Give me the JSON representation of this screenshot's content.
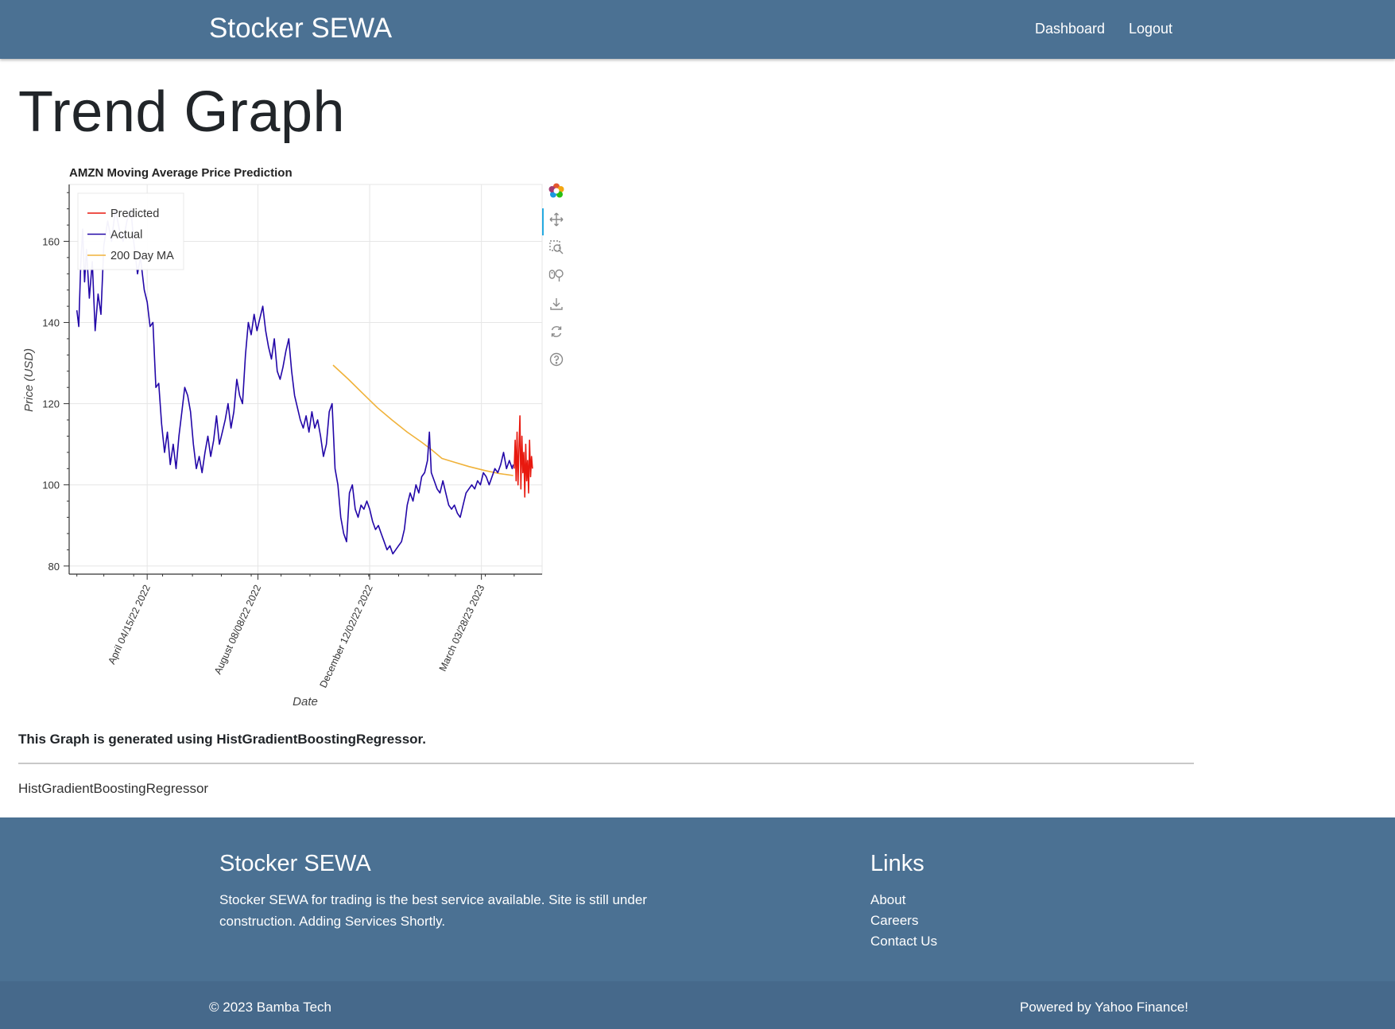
{
  "navbar": {
    "brand": "Stocker SEWA",
    "links": [
      "Dashboard",
      "Logout"
    ]
  },
  "page": {
    "title": "Trend Graph",
    "caption": "This Graph is generated using HistGradientBoostingRegressor.",
    "model_name": "HistGradientBoostingRegressor"
  },
  "toolbar": {
    "icons": [
      "bokeh-logo-icon",
      "pan-icon",
      "box-zoom-icon",
      "wheel-zoom-icon",
      "save-icon",
      "reset-icon",
      "help-icon"
    ]
  },
  "chart_data": {
    "type": "line",
    "title": "AMZN Moving Average Price Prediction",
    "xlabel": "Date",
    "ylabel": "Price (USD)",
    "ylim": [
      78,
      174
    ],
    "xlim": [
      "2022-01-24",
      "2023-05-30"
    ],
    "x_ticks": [
      {
        "date": "2022-04-15",
        "label": "April 04/15/22 2022"
      },
      {
        "date": "2022-08-08",
        "label": "August 08/08/22 2022"
      },
      {
        "date": "2022-12-02",
        "label": "December 12/02/22 2022"
      },
      {
        "date": "2023-03-28",
        "label": "March 03/28/23 2023"
      }
    ],
    "y_ticks": [
      80,
      100,
      120,
      140,
      160
    ],
    "grid": true,
    "legend_position": "top-left",
    "series": [
      {
        "name": "Predicted",
        "color": "#e8190f",
        "points": [
          [
            "2023-05-01",
            104
          ],
          [
            "2023-05-02",
            111
          ],
          [
            "2023-05-03",
            101
          ],
          [
            "2023-05-04",
            113
          ],
          [
            "2023-05-05",
            100
          ],
          [
            "2023-05-06",
            109
          ],
          [
            "2023-05-07",
            117
          ],
          [
            "2023-05-08",
            99
          ],
          [
            "2023-05-09",
            112
          ],
          [
            "2023-05-10",
            103
          ],
          [
            "2023-05-11",
            108
          ],
          [
            "2023-05-12",
            97
          ],
          [
            "2023-05-13",
            110
          ],
          [
            "2023-05-14",
            101
          ],
          [
            "2023-05-15",
            106
          ],
          [
            "2023-05-16",
            98
          ],
          [
            "2023-05-17",
            111
          ],
          [
            "2023-05-18",
            102
          ],
          [
            "2023-05-19",
            107
          ],
          [
            "2023-05-20",
            104
          ]
        ]
      },
      {
        "name": "Actual",
        "color": "#2307a8",
        "points": [
          [
            "2022-02-01",
            143
          ],
          [
            "2022-02-03",
            139
          ],
          [
            "2022-02-05",
            154
          ],
          [
            "2022-02-07",
            163
          ],
          [
            "2022-02-09",
            150
          ],
          [
            "2022-02-11",
            158
          ],
          [
            "2022-02-14",
            146
          ],
          [
            "2022-02-17",
            155
          ],
          [
            "2022-02-20",
            138
          ],
          [
            "2022-02-23",
            147
          ],
          [
            "2022-02-26",
            142
          ],
          [
            "2022-03-01",
            159
          ],
          [
            "2022-03-05",
            165
          ],
          [
            "2022-03-09",
            160
          ],
          [
            "2022-03-13",
            168
          ],
          [
            "2022-03-17",
            163
          ],
          [
            "2022-03-21",
            160
          ],
          [
            "2022-03-25",
            165
          ],
          [
            "2022-03-29",
            168
          ],
          [
            "2022-04-01",
            160
          ],
          [
            "2022-04-05",
            152
          ],
          [
            "2022-04-08",
            156
          ],
          [
            "2022-04-12",
            148
          ],
          [
            "2022-04-15",
            145
          ],
          [
            "2022-04-18",
            139
          ],
          [
            "2022-04-21",
            140
          ],
          [
            "2022-04-24",
            124
          ],
          [
            "2022-04-27",
            125
          ],
          [
            "2022-04-30",
            115
          ],
          [
            "2022-05-03",
            108
          ],
          [
            "2022-05-06",
            113
          ],
          [
            "2022-05-09",
            105
          ],
          [
            "2022-05-12",
            110
          ],
          [
            "2022-05-15",
            104
          ],
          [
            "2022-05-18",
            112
          ],
          [
            "2022-05-21",
            118
          ],
          [
            "2022-05-24",
            124
          ],
          [
            "2022-05-27",
            122
          ],
          [
            "2022-05-30",
            118
          ],
          [
            "2022-06-02",
            110
          ],
          [
            "2022-06-05",
            104
          ],
          [
            "2022-06-08",
            107
          ],
          [
            "2022-06-11",
            103
          ],
          [
            "2022-06-14",
            108
          ],
          [
            "2022-06-17",
            112
          ],
          [
            "2022-06-20",
            107
          ],
          [
            "2022-06-23",
            111
          ],
          [
            "2022-06-26",
            117
          ],
          [
            "2022-06-29",
            110
          ],
          [
            "2022-07-02",
            113
          ],
          [
            "2022-07-05",
            116
          ],
          [
            "2022-07-08",
            120
          ],
          [
            "2022-07-11",
            114
          ],
          [
            "2022-07-14",
            118
          ],
          [
            "2022-07-17",
            126
          ],
          [
            "2022-07-20",
            122
          ],
          [
            "2022-07-23",
            120
          ],
          [
            "2022-07-26",
            132
          ],
          [
            "2022-07-29",
            140
          ],
          [
            "2022-08-01",
            137
          ],
          [
            "2022-08-04",
            142
          ],
          [
            "2022-08-07",
            138
          ],
          [
            "2022-08-10",
            141
          ],
          [
            "2022-08-13",
            144
          ],
          [
            "2022-08-16",
            138
          ],
          [
            "2022-08-19",
            134
          ],
          [
            "2022-08-22",
            131
          ],
          [
            "2022-08-25",
            136
          ],
          [
            "2022-08-28",
            128
          ],
          [
            "2022-08-31",
            126
          ],
          [
            "2022-09-03",
            129
          ],
          [
            "2022-09-06",
            133
          ],
          [
            "2022-09-09",
            136
          ],
          [
            "2022-09-12",
            128
          ],
          [
            "2022-09-15",
            122
          ],
          [
            "2022-09-18",
            119
          ],
          [
            "2022-09-21",
            116
          ],
          [
            "2022-09-24",
            114
          ],
          [
            "2022-09-27",
            117
          ],
          [
            "2022-09-30",
            113
          ],
          [
            "2022-10-03",
            118
          ],
          [
            "2022-10-06",
            114
          ],
          [
            "2022-10-09",
            116
          ],
          [
            "2022-10-12",
            112
          ],
          [
            "2022-10-15",
            107
          ],
          [
            "2022-10-18",
            110
          ],
          [
            "2022-10-21",
            118
          ],
          [
            "2022-10-24",
            120
          ],
          [
            "2022-10-27",
            104
          ],
          [
            "2022-10-30",
            100
          ],
          [
            "2022-11-02",
            92
          ],
          [
            "2022-11-05",
            88
          ],
          [
            "2022-11-08",
            86
          ],
          [
            "2022-11-11",
            98
          ],
          [
            "2022-11-14",
            100
          ],
          [
            "2022-11-17",
            94
          ],
          [
            "2022-11-20",
            92
          ],
          [
            "2022-11-23",
            95
          ],
          [
            "2022-11-26",
            94
          ],
          [
            "2022-11-29",
            96
          ],
          [
            "2022-12-02",
            94
          ],
          [
            "2022-12-05",
            91
          ],
          [
            "2022-12-08",
            89
          ],
          [
            "2022-12-11",
            90
          ],
          [
            "2022-12-14",
            88
          ],
          [
            "2022-12-17",
            86
          ],
          [
            "2022-12-20",
            84
          ],
          [
            "2022-12-23",
            85
          ],
          [
            "2022-12-26",
            83
          ],
          [
            "2022-12-29",
            84
          ],
          [
            "2023-01-01",
            85
          ],
          [
            "2023-01-04",
            86
          ],
          [
            "2023-01-07",
            89
          ],
          [
            "2023-01-10",
            95
          ],
          [
            "2023-01-13",
            98
          ],
          [
            "2023-01-16",
            96
          ],
          [
            "2023-01-19",
            100
          ],
          [
            "2023-01-22",
            98
          ],
          [
            "2023-01-25",
            102
          ],
          [
            "2023-01-28",
            103
          ],
          [
            "2023-01-31",
            106
          ],
          [
            "2023-02-02",
            113
          ],
          [
            "2023-02-04",
            103
          ],
          [
            "2023-02-07",
            101
          ],
          [
            "2023-02-10",
            99
          ],
          [
            "2023-02-13",
            98
          ],
          [
            "2023-02-16",
            101
          ],
          [
            "2023-02-19",
            98
          ],
          [
            "2023-02-22",
            95
          ],
          [
            "2023-02-25",
            94
          ],
          [
            "2023-02-28",
            95
          ],
          [
            "2023-03-03",
            93
          ],
          [
            "2023-03-06",
            92
          ],
          [
            "2023-03-09",
            95
          ],
          [
            "2023-03-12",
            98
          ],
          [
            "2023-03-15",
            99
          ],
          [
            "2023-03-18",
            100
          ],
          [
            "2023-03-21",
            99
          ],
          [
            "2023-03-24",
            101
          ],
          [
            "2023-03-27",
            100
          ],
          [
            "2023-03-30",
            103
          ],
          [
            "2023-04-02",
            102
          ],
          [
            "2023-04-05",
            100
          ],
          [
            "2023-04-08",
            102
          ],
          [
            "2023-04-11",
            104
          ],
          [
            "2023-04-14",
            103
          ],
          [
            "2023-04-17",
            105
          ],
          [
            "2023-04-20",
            108
          ],
          [
            "2023-04-23",
            104
          ],
          [
            "2023-04-26",
            106
          ],
          [
            "2023-04-29",
            104
          ],
          [
            "2023-04-30",
            105
          ]
        ]
      },
      {
        "name": "200 Day MA",
        "color": "#f0b23a",
        "points": [
          [
            "2022-10-25",
            129.5
          ],
          [
            "2022-11-10",
            126
          ],
          [
            "2022-11-25",
            122.5
          ],
          [
            "2022-12-10",
            119
          ],
          [
            "2022-12-25",
            116
          ],
          [
            "2023-01-10",
            113
          ],
          [
            "2023-01-25",
            110.5
          ],
          [
            "2023-02-05",
            108.5
          ],
          [
            "2023-02-15",
            106.5
          ],
          [
            "2023-03-01",
            105.5
          ],
          [
            "2023-03-15",
            104.5
          ],
          [
            "2023-04-01",
            103.5
          ],
          [
            "2023-04-15",
            102.8
          ],
          [
            "2023-04-30",
            102.3
          ]
        ]
      }
    ]
  },
  "footer": {
    "brand": "Stocker SEWA",
    "description": "Stocker SEWA for trading is the best service available. Site is still under construction. Adding Services Shortly.",
    "links_title": "Links",
    "links": [
      "About",
      "Careers",
      "Contact Us"
    ],
    "copyright": "© 2023 Bamba Tech",
    "powered_by": "Powered by Yahoo Finance!"
  }
}
